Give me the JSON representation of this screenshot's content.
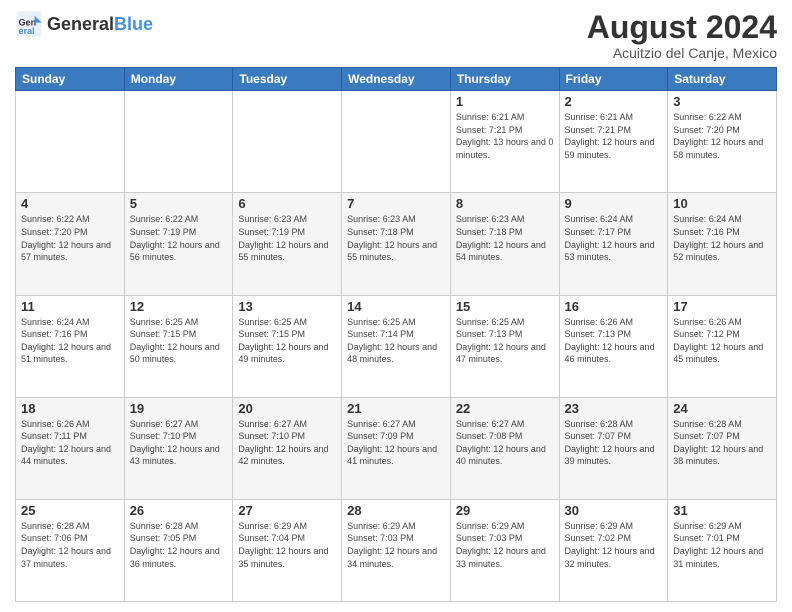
{
  "logo": {
    "text_general": "General",
    "text_blue": "Blue"
  },
  "header": {
    "title": "August 2024",
    "subtitle": "Acuitzio del Canje, Mexico"
  },
  "weekdays": [
    "Sunday",
    "Monday",
    "Tuesday",
    "Wednesday",
    "Thursday",
    "Friday",
    "Saturday"
  ],
  "weeks": [
    [
      {
        "day": "",
        "sunrise": "",
        "sunset": "",
        "daylight": ""
      },
      {
        "day": "",
        "sunrise": "",
        "sunset": "",
        "daylight": ""
      },
      {
        "day": "",
        "sunrise": "",
        "sunset": "",
        "daylight": ""
      },
      {
        "day": "",
        "sunrise": "",
        "sunset": "",
        "daylight": ""
      },
      {
        "day": "1",
        "sunrise": "Sunrise: 6:21 AM",
        "sunset": "Sunset: 7:21 PM",
        "daylight": "Daylight: 13 hours and 0 minutes."
      },
      {
        "day": "2",
        "sunrise": "Sunrise: 6:21 AM",
        "sunset": "Sunset: 7:21 PM",
        "daylight": "Daylight: 12 hours and 59 minutes."
      },
      {
        "day": "3",
        "sunrise": "Sunrise: 6:22 AM",
        "sunset": "Sunset: 7:20 PM",
        "daylight": "Daylight: 12 hours and 58 minutes."
      }
    ],
    [
      {
        "day": "4",
        "sunrise": "Sunrise: 6:22 AM",
        "sunset": "Sunset: 7:20 PM",
        "daylight": "Daylight: 12 hours and 57 minutes."
      },
      {
        "day": "5",
        "sunrise": "Sunrise: 6:22 AM",
        "sunset": "Sunset: 7:19 PM",
        "daylight": "Daylight: 12 hours and 56 minutes."
      },
      {
        "day": "6",
        "sunrise": "Sunrise: 6:23 AM",
        "sunset": "Sunset: 7:19 PM",
        "daylight": "Daylight: 12 hours and 55 minutes."
      },
      {
        "day": "7",
        "sunrise": "Sunrise: 6:23 AM",
        "sunset": "Sunset: 7:18 PM",
        "daylight": "Daylight: 12 hours and 55 minutes."
      },
      {
        "day": "8",
        "sunrise": "Sunrise: 6:23 AM",
        "sunset": "Sunset: 7:18 PM",
        "daylight": "Daylight: 12 hours and 54 minutes."
      },
      {
        "day": "9",
        "sunrise": "Sunrise: 6:24 AM",
        "sunset": "Sunset: 7:17 PM",
        "daylight": "Daylight: 12 hours and 53 minutes."
      },
      {
        "day": "10",
        "sunrise": "Sunrise: 6:24 AM",
        "sunset": "Sunset: 7:16 PM",
        "daylight": "Daylight: 12 hours and 52 minutes."
      }
    ],
    [
      {
        "day": "11",
        "sunrise": "Sunrise: 6:24 AM",
        "sunset": "Sunset: 7:16 PM",
        "daylight": "Daylight: 12 hours and 51 minutes."
      },
      {
        "day": "12",
        "sunrise": "Sunrise: 6:25 AM",
        "sunset": "Sunset: 7:15 PM",
        "daylight": "Daylight: 12 hours and 50 minutes."
      },
      {
        "day": "13",
        "sunrise": "Sunrise: 6:25 AM",
        "sunset": "Sunset: 7:15 PM",
        "daylight": "Daylight: 12 hours and 49 minutes."
      },
      {
        "day": "14",
        "sunrise": "Sunrise: 6:25 AM",
        "sunset": "Sunset: 7:14 PM",
        "daylight": "Daylight: 12 hours and 48 minutes."
      },
      {
        "day": "15",
        "sunrise": "Sunrise: 6:25 AM",
        "sunset": "Sunset: 7:13 PM",
        "daylight": "Daylight: 12 hours and 47 minutes."
      },
      {
        "day": "16",
        "sunrise": "Sunrise: 6:26 AM",
        "sunset": "Sunset: 7:13 PM",
        "daylight": "Daylight: 12 hours and 46 minutes."
      },
      {
        "day": "17",
        "sunrise": "Sunrise: 6:26 AM",
        "sunset": "Sunset: 7:12 PM",
        "daylight": "Daylight: 12 hours and 45 minutes."
      }
    ],
    [
      {
        "day": "18",
        "sunrise": "Sunrise: 6:26 AM",
        "sunset": "Sunset: 7:11 PM",
        "daylight": "Daylight: 12 hours and 44 minutes."
      },
      {
        "day": "19",
        "sunrise": "Sunrise: 6:27 AM",
        "sunset": "Sunset: 7:10 PM",
        "daylight": "Daylight: 12 hours and 43 minutes."
      },
      {
        "day": "20",
        "sunrise": "Sunrise: 6:27 AM",
        "sunset": "Sunset: 7:10 PM",
        "daylight": "Daylight: 12 hours and 42 minutes."
      },
      {
        "day": "21",
        "sunrise": "Sunrise: 6:27 AM",
        "sunset": "Sunset: 7:09 PM",
        "daylight": "Daylight: 12 hours and 41 minutes."
      },
      {
        "day": "22",
        "sunrise": "Sunrise: 6:27 AM",
        "sunset": "Sunset: 7:08 PM",
        "daylight": "Daylight: 12 hours and 40 minutes."
      },
      {
        "day": "23",
        "sunrise": "Sunrise: 6:28 AM",
        "sunset": "Sunset: 7:07 PM",
        "daylight": "Daylight: 12 hours and 39 minutes."
      },
      {
        "day": "24",
        "sunrise": "Sunrise: 6:28 AM",
        "sunset": "Sunset: 7:07 PM",
        "daylight": "Daylight: 12 hours and 38 minutes."
      }
    ],
    [
      {
        "day": "25",
        "sunrise": "Sunrise: 6:28 AM",
        "sunset": "Sunset: 7:06 PM",
        "daylight": "Daylight: 12 hours and 37 minutes."
      },
      {
        "day": "26",
        "sunrise": "Sunrise: 6:28 AM",
        "sunset": "Sunset: 7:05 PM",
        "daylight": "Daylight: 12 hours and 36 minutes."
      },
      {
        "day": "27",
        "sunrise": "Sunrise: 6:29 AM",
        "sunset": "Sunset: 7:04 PM",
        "daylight": "Daylight: 12 hours and 35 minutes."
      },
      {
        "day": "28",
        "sunrise": "Sunrise: 6:29 AM",
        "sunset": "Sunset: 7:03 PM",
        "daylight": "Daylight: 12 hours and 34 minutes."
      },
      {
        "day": "29",
        "sunrise": "Sunrise: 6:29 AM",
        "sunset": "Sunset: 7:03 PM",
        "daylight": "Daylight: 12 hours and 33 minutes."
      },
      {
        "day": "30",
        "sunrise": "Sunrise: 6:29 AM",
        "sunset": "Sunset: 7:02 PM",
        "daylight": "Daylight: 12 hours and 32 minutes."
      },
      {
        "day": "31",
        "sunrise": "Sunrise: 6:29 AM",
        "sunset": "Sunset: 7:01 PM",
        "daylight": "Daylight: 12 hours and 31 minutes."
      }
    ]
  ]
}
